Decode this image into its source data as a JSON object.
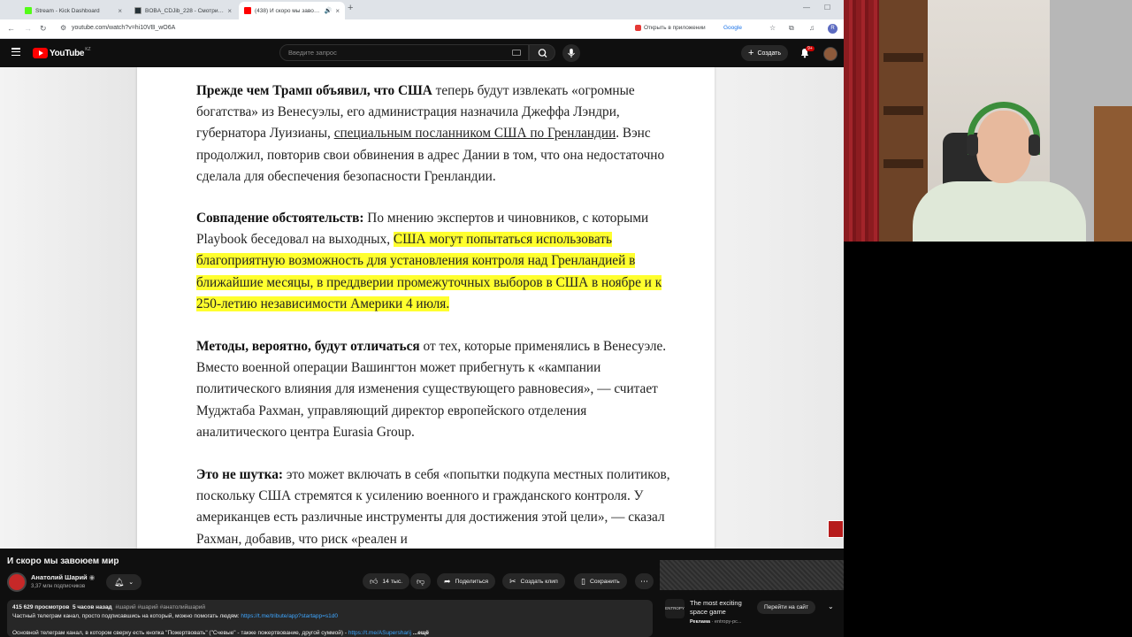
{
  "browser": {
    "tabs": [
      {
        "label": "Stream - Kick Dashboard",
        "favicon_color": "#53fc18"
      },
      {
        "label": "BOBA_CDJib_228 - Смотрите в...",
        "favicon_color": "#263238"
      },
      {
        "label": "(438) И скоро мы завоюе...",
        "favicon_color": "#ff0000"
      }
    ],
    "url": "youtube.com/watch?v=hi10VB_wO6A",
    "open_in_app": "Открыть в приложении",
    "google_chip": "Google",
    "profile_letter": "R"
  },
  "youtube": {
    "logo_text": "YouTube",
    "country_code": "KZ",
    "search_placeholder": "Введите запрос",
    "create_label": "Создать",
    "notif_badge": "9+"
  },
  "article": {
    "p1_bold": "Прежде чем Трамп объявил, что США",
    "p1_text_a": " теперь будут извлекать «огромные богатства» из Венесуэлы, его администрация назначила Джеффа Лэндри, губернатора Луизианы, ",
    "p1_link": "специальным посланником США по Гренландии",
    "p1_text_b": ". Вэнс продолжил, повторив свои обвинения в адрес Дании в том, что она недостаточно сделала для обеспечения безопасности Гренландии.",
    "p2_bold": "Совпадение обстоятельств:",
    "p2_text": " По мнению экспертов и чиновников, с которыми Playbook беседовал на выходных, ",
    "p2_highlight": "США могут попытаться использовать благоприятную возможность для установления контроля над Гренландией в ближайшие месяцы, в преддверии промежуточных выборов в США в ноябре и к 250-летию независимости Америки 4 июля.",
    "p3_bold": "Методы, вероятно, будут отличаться",
    "p3_text": " от тех, которые применялись в Венесуэле. Вместо военной операции Вашингтон может прибегнуть к «кампании политического влияния для изменения существующего равновесия», — считает Муджтаба Рахман, управляющий директор европейского отделения аналитического центра Eurasia Group.",
    "p4_bold": "Это не шутка:",
    "p4_text": "  это может включать в себя «попытки подкупа местных политиков, поскольку США стремятся к усилению военного и гражданского контроля. У американцев есть различные инструменты для достижения этой цели», — сказал Рахман, добавив, что риск «реален и"
  },
  "video": {
    "title": "И скоро мы завоюем мир",
    "channel_name": "Анатолий Шарий",
    "verified": "◉",
    "subscribers": "3,37 млн подписчиков",
    "likes": "14 тыс.",
    "share": "Поделиться",
    "clip": "Создать клип",
    "save": "Сохранить",
    "views": "415 629 просмотров",
    "age": "5 часов назад",
    "hashtags": "#шарий #шарий #анатолийшарий",
    "desc_line1": "Частный телеграм канал, просто подписавшись на который, можно помогать людям: ",
    "desc_link1": "https://t.me/tribute/app?startapp=s1d0",
    "desc_line2": "Основной телеграм канал, в котором сверху есть кнопка \"Пожертвовать\" (\"Счевые\" - также пожертвование, другой суммой) - ",
    "desc_link2": "https://t.me/ASupersharij",
    "desc_more": "...ещё"
  },
  "ad": {
    "logo_text": "ENTROPY",
    "title": "The most exciting space game",
    "sponsor_label": "Реклама",
    "sponsor_domain": "entropy-pc...",
    "cta": "Перейти на сайт"
  }
}
